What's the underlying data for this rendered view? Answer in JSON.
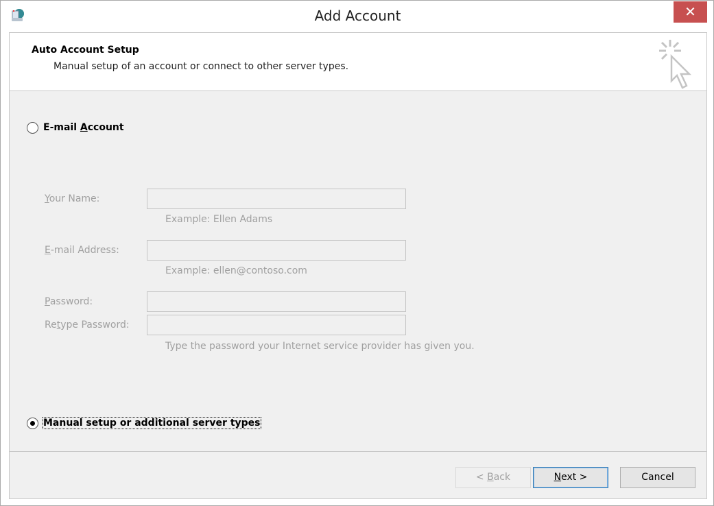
{
  "window": {
    "title": "Add Account",
    "close_label": "✕"
  },
  "header": {
    "title": "Auto Account Setup",
    "subtitle": "Manual setup of an account or connect to other server types."
  },
  "options": {
    "email_account": {
      "label_pre": "E-mail ",
      "label_u": "A",
      "label_post": "ccount",
      "selected": false
    },
    "manual": {
      "label": "Manual setup or additional server types",
      "selected": true
    }
  },
  "form": {
    "name": {
      "label_u": "Y",
      "label_rest": "our Name:",
      "value": "",
      "hint": "Example: Ellen Adams"
    },
    "email": {
      "label_u": "E",
      "label_rest": "-mail Address:",
      "value": "",
      "hint": "Example: ellen@contoso.com"
    },
    "password": {
      "label_u": "P",
      "label_rest": "assword:",
      "value": ""
    },
    "retype": {
      "label_pre": "Re",
      "label_u": "t",
      "label_rest": "ype Password:",
      "value": ""
    },
    "password_hint": "Type the password your Internet service provider has given you."
  },
  "buttons": {
    "back": {
      "pre": "< ",
      "u": "B",
      "rest": "ack"
    },
    "next": {
      "u": "N",
      "rest": "ext >"
    },
    "cancel": "Cancel"
  }
}
